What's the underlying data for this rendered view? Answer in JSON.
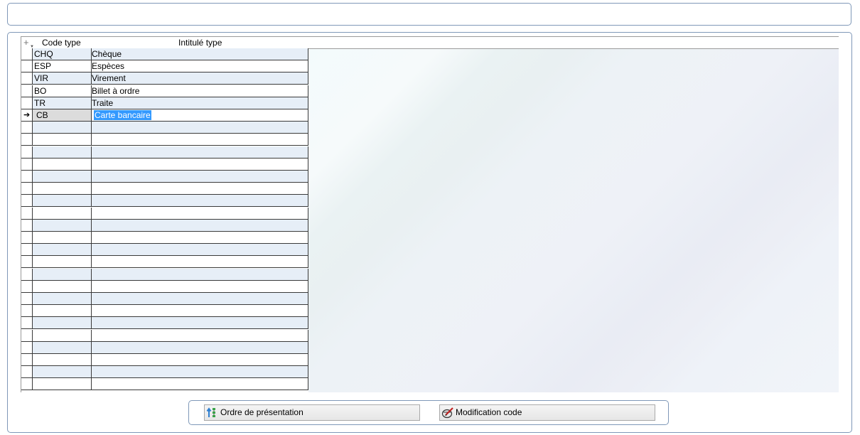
{
  "grid": {
    "headers": {
      "code": "Code type",
      "label": "Intitulé type",
      "add_icon": "+"
    },
    "rows": [
      {
        "code": "CHQ",
        "label": "Chèque"
      },
      {
        "code": "ESP",
        "label": "Espèces"
      },
      {
        "code": "VIR",
        "label": "Virement"
      },
      {
        "code": "BO",
        "label": "Billet à ordre"
      },
      {
        "code": "TR",
        "label": "Traite"
      },
      {
        "code": "CB",
        "label": "Carte bancaire"
      }
    ],
    "current_row_index": 5,
    "total_visible_rows": 28
  },
  "buttons": {
    "order_label": "Ordre de présentation",
    "order_icon": "sort-order-icon",
    "modify_label": "Modification code",
    "modify_icon": "edit-code-icon"
  },
  "colors": {
    "panel_border": "#7f98b8",
    "alt_row": "#e6eef7",
    "selection": "#3399ff"
  }
}
